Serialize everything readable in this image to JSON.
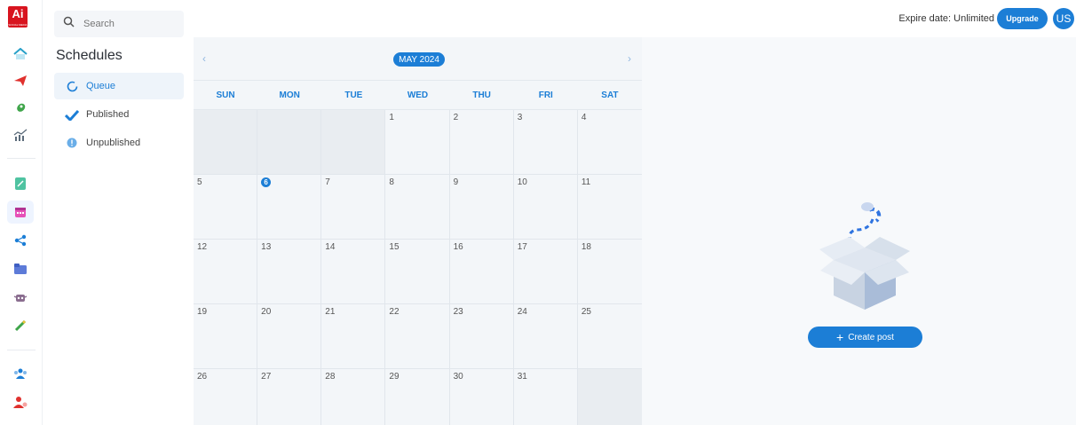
{
  "brand": {
    "logo_text": "Ai",
    "logo_subtext": "SOCIAL MEDIA",
    "logo_color": "#d8141f"
  },
  "rail": {
    "icons": [
      "home-icon",
      "send-icon",
      "rocket-icon",
      "analytics-icon",
      "post-editor-icon",
      "calendar-icon",
      "share-icon",
      "folder-icon",
      "bot-icon",
      "magic-wand-icon",
      "team-icon",
      "user-add-icon"
    ],
    "active": "calendar-icon"
  },
  "sidebar": {
    "search_placeholder": "Search",
    "title": "Schedules",
    "items": [
      {
        "label": "Queue",
        "icon": "circle-icon",
        "active": true
      },
      {
        "label": "Published",
        "icon": "check-icon",
        "active": false
      },
      {
        "label": "Unpublished",
        "icon": "alert-icon",
        "active": false
      }
    ]
  },
  "topbar": {
    "expire_label": "Expire date: Unlimited",
    "upgrade_label": "Upgrade",
    "avatar_initials": "US"
  },
  "calendar": {
    "month_label": "MAY 2024",
    "days_of_week": [
      "SUN",
      "MON",
      "TUE",
      "WED",
      "THU",
      "FRI",
      "SAT"
    ],
    "today": "6",
    "cells": [
      {
        "d": "",
        "m": true
      },
      {
        "d": "",
        "m": true
      },
      {
        "d": "",
        "m": true
      },
      {
        "d": "1"
      },
      {
        "d": "2"
      },
      {
        "d": "3"
      },
      {
        "d": "4"
      },
      {
        "d": "5"
      },
      {
        "d": "6",
        "today": true
      },
      {
        "d": "7"
      },
      {
        "d": "8"
      },
      {
        "d": "9"
      },
      {
        "d": "10"
      },
      {
        "d": "11"
      },
      {
        "d": "12"
      },
      {
        "d": "13"
      },
      {
        "d": "14"
      },
      {
        "d": "15"
      },
      {
        "d": "16"
      },
      {
        "d": "17"
      },
      {
        "d": "18"
      },
      {
        "d": "19"
      },
      {
        "d": "20"
      },
      {
        "d": "21"
      },
      {
        "d": "22"
      },
      {
        "d": "23"
      },
      {
        "d": "24"
      },
      {
        "d": "25"
      },
      {
        "d": "26"
      },
      {
        "d": "27"
      },
      {
        "d": "28"
      },
      {
        "d": "29"
      },
      {
        "d": "30"
      },
      {
        "d": "31"
      },
      {
        "d": "",
        "m": true
      }
    ]
  },
  "empty_state": {
    "create_label": "Create post"
  },
  "colors": {
    "accent": "#1c7ed6",
    "calendar_bg": "#f3f6f9",
    "muted_cell": "#e9edf1"
  }
}
